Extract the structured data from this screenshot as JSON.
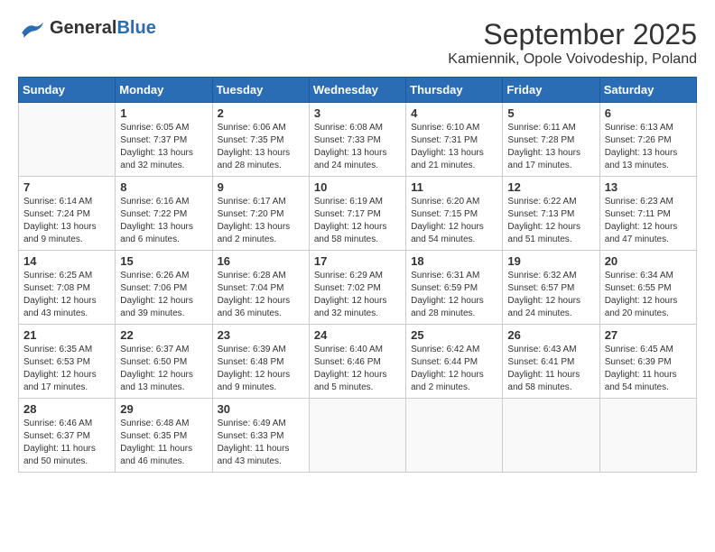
{
  "header": {
    "logo_general": "General",
    "logo_blue": "Blue",
    "month_title": "September 2025",
    "location": "Kamiennik, Opole Voivodeship, Poland"
  },
  "weekdays": [
    "Sunday",
    "Monday",
    "Tuesday",
    "Wednesday",
    "Thursday",
    "Friday",
    "Saturday"
  ],
  "weeks": [
    [
      {
        "day": "",
        "info": ""
      },
      {
        "day": "1",
        "info": "Sunrise: 6:05 AM\nSunset: 7:37 PM\nDaylight: 13 hours\nand 32 minutes."
      },
      {
        "day": "2",
        "info": "Sunrise: 6:06 AM\nSunset: 7:35 PM\nDaylight: 13 hours\nand 28 minutes."
      },
      {
        "day": "3",
        "info": "Sunrise: 6:08 AM\nSunset: 7:33 PM\nDaylight: 13 hours\nand 24 minutes."
      },
      {
        "day": "4",
        "info": "Sunrise: 6:10 AM\nSunset: 7:31 PM\nDaylight: 13 hours\nand 21 minutes."
      },
      {
        "day": "5",
        "info": "Sunrise: 6:11 AM\nSunset: 7:28 PM\nDaylight: 13 hours\nand 17 minutes."
      },
      {
        "day": "6",
        "info": "Sunrise: 6:13 AM\nSunset: 7:26 PM\nDaylight: 13 hours\nand 13 minutes."
      }
    ],
    [
      {
        "day": "7",
        "info": "Sunrise: 6:14 AM\nSunset: 7:24 PM\nDaylight: 13 hours\nand 9 minutes."
      },
      {
        "day": "8",
        "info": "Sunrise: 6:16 AM\nSunset: 7:22 PM\nDaylight: 13 hours\nand 6 minutes."
      },
      {
        "day": "9",
        "info": "Sunrise: 6:17 AM\nSunset: 7:20 PM\nDaylight: 13 hours\nand 2 minutes."
      },
      {
        "day": "10",
        "info": "Sunrise: 6:19 AM\nSunset: 7:17 PM\nDaylight: 12 hours\nand 58 minutes."
      },
      {
        "day": "11",
        "info": "Sunrise: 6:20 AM\nSunset: 7:15 PM\nDaylight: 12 hours\nand 54 minutes."
      },
      {
        "day": "12",
        "info": "Sunrise: 6:22 AM\nSunset: 7:13 PM\nDaylight: 12 hours\nand 51 minutes."
      },
      {
        "day": "13",
        "info": "Sunrise: 6:23 AM\nSunset: 7:11 PM\nDaylight: 12 hours\nand 47 minutes."
      }
    ],
    [
      {
        "day": "14",
        "info": "Sunrise: 6:25 AM\nSunset: 7:08 PM\nDaylight: 12 hours\nand 43 minutes."
      },
      {
        "day": "15",
        "info": "Sunrise: 6:26 AM\nSunset: 7:06 PM\nDaylight: 12 hours\nand 39 minutes."
      },
      {
        "day": "16",
        "info": "Sunrise: 6:28 AM\nSunset: 7:04 PM\nDaylight: 12 hours\nand 36 minutes."
      },
      {
        "day": "17",
        "info": "Sunrise: 6:29 AM\nSunset: 7:02 PM\nDaylight: 12 hours\nand 32 minutes."
      },
      {
        "day": "18",
        "info": "Sunrise: 6:31 AM\nSunset: 6:59 PM\nDaylight: 12 hours\nand 28 minutes."
      },
      {
        "day": "19",
        "info": "Sunrise: 6:32 AM\nSunset: 6:57 PM\nDaylight: 12 hours\nand 24 minutes."
      },
      {
        "day": "20",
        "info": "Sunrise: 6:34 AM\nSunset: 6:55 PM\nDaylight: 12 hours\nand 20 minutes."
      }
    ],
    [
      {
        "day": "21",
        "info": "Sunrise: 6:35 AM\nSunset: 6:53 PM\nDaylight: 12 hours\nand 17 minutes."
      },
      {
        "day": "22",
        "info": "Sunrise: 6:37 AM\nSunset: 6:50 PM\nDaylight: 12 hours\nand 13 minutes."
      },
      {
        "day": "23",
        "info": "Sunrise: 6:39 AM\nSunset: 6:48 PM\nDaylight: 12 hours\nand 9 minutes."
      },
      {
        "day": "24",
        "info": "Sunrise: 6:40 AM\nSunset: 6:46 PM\nDaylight: 12 hours\nand 5 minutes."
      },
      {
        "day": "25",
        "info": "Sunrise: 6:42 AM\nSunset: 6:44 PM\nDaylight: 12 hours\nand 2 minutes."
      },
      {
        "day": "26",
        "info": "Sunrise: 6:43 AM\nSunset: 6:41 PM\nDaylight: 11 hours\nand 58 minutes."
      },
      {
        "day": "27",
        "info": "Sunrise: 6:45 AM\nSunset: 6:39 PM\nDaylight: 11 hours\nand 54 minutes."
      }
    ],
    [
      {
        "day": "28",
        "info": "Sunrise: 6:46 AM\nSunset: 6:37 PM\nDaylight: 11 hours\nand 50 minutes."
      },
      {
        "day": "29",
        "info": "Sunrise: 6:48 AM\nSunset: 6:35 PM\nDaylight: 11 hours\nand 46 minutes."
      },
      {
        "day": "30",
        "info": "Sunrise: 6:49 AM\nSunset: 6:33 PM\nDaylight: 11 hours\nand 43 minutes."
      },
      {
        "day": "",
        "info": ""
      },
      {
        "day": "",
        "info": ""
      },
      {
        "day": "",
        "info": ""
      },
      {
        "day": "",
        "info": ""
      }
    ]
  ]
}
